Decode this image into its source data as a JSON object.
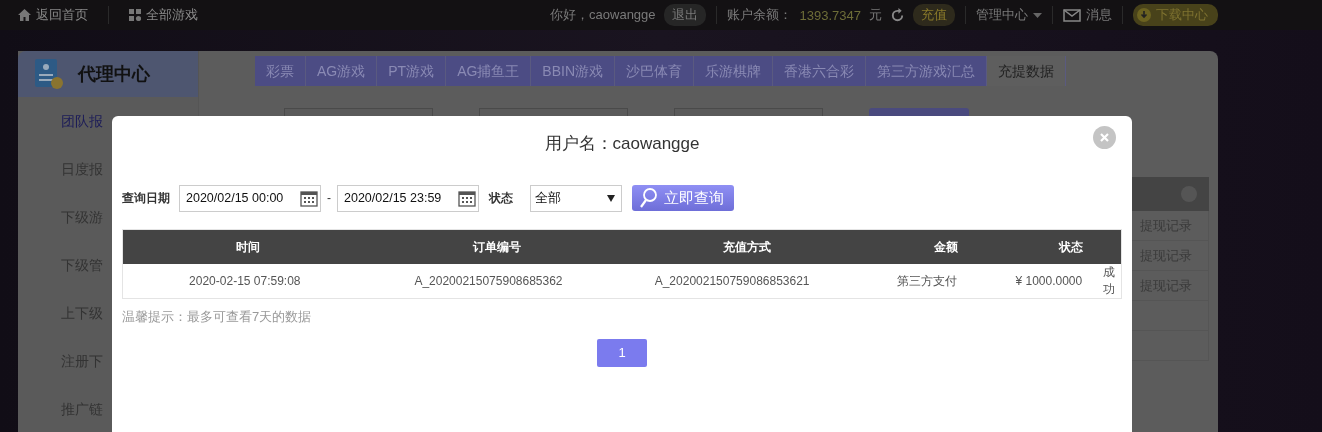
{
  "top_bar": {
    "home_link": "返回首页",
    "games_link": "全部游戏",
    "greeting": "你好，caowangge",
    "logout": "退出",
    "balance_label": "账户余额：",
    "balance": "1393.7347",
    "currency": "元",
    "recharge": "充值",
    "management": "管理中心",
    "messages": "消息",
    "download": "下载中心"
  },
  "panel": {
    "title": "代理中心",
    "tabs": [
      {
        "label": "彩票",
        "selected": false
      },
      {
        "label": "AG游戏",
        "selected": false
      },
      {
        "label": "PT游戏",
        "selected": false
      },
      {
        "label": "AG捕鱼王",
        "selected": false
      },
      {
        "label": "BBIN游戏",
        "selected": false
      },
      {
        "label": "沙巴体育",
        "selected": false
      },
      {
        "label": "乐游棋牌",
        "selected": false
      },
      {
        "label": "香港六合彩",
        "selected": false
      },
      {
        "label": "第三方游戏汇总",
        "selected": false
      },
      {
        "label": "充提数据",
        "selected": true
      }
    ],
    "sidebar": [
      {
        "label": "团队报",
        "selected": true
      },
      {
        "label": "日度报",
        "selected": false
      },
      {
        "label": "下级游",
        "selected": false
      },
      {
        "label": "下级管",
        "selected": false
      },
      {
        "label": "上下级",
        "selected": false
      },
      {
        "label": "注册下",
        "selected": false
      },
      {
        "label": "推广链",
        "selected": false
      }
    ],
    "right_column": [
      "提现记录",
      "提现记录",
      "提现记录"
    ]
  },
  "modal": {
    "title": "用户名：caowangge",
    "date_label": "查询日期",
    "start_date": "2020/02/15 00:00",
    "separator": "-",
    "end_date": "2020/02/15 23:59",
    "status_label": "状态",
    "status_value": "全部",
    "query_button": "立即查询",
    "table": {
      "columns": [
        "时间",
        "订单编号",
        "充值方式",
        "金额",
        "状态"
      ],
      "rows": [
        [
          "2020-02-15 07:59:08",
          "A_20200215075908685362",
          "A_20200215075908685362​1",
          "第三方支付",
          "¥ 1000.0000",
          "成功"
        ]
      ]
    },
    "hint": "温馨提示：最多可查看7天的数据",
    "pages": [
      {
        "label": "1",
        "selected": true
      }
    ]
  }
}
